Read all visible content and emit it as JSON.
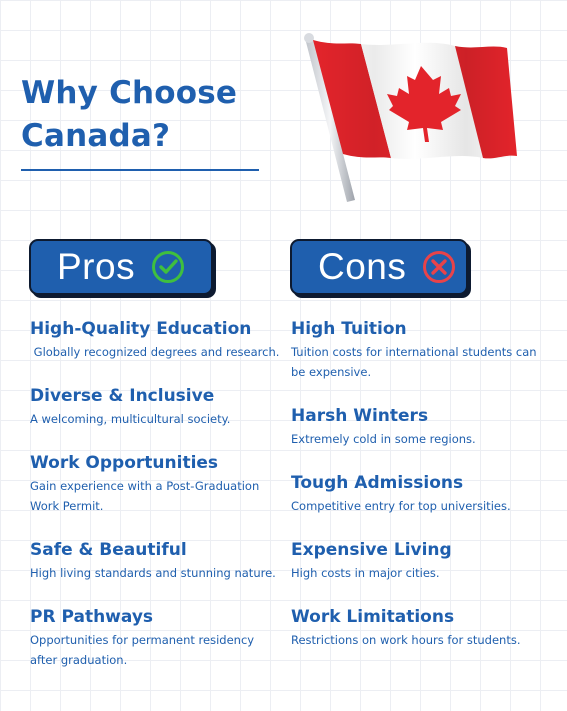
{
  "header": {
    "title_line1": "Why Choose",
    "title_line2": "Canada?"
  },
  "colors": {
    "primary_blue": "#1f5fae",
    "check_green": "#3fbf3f",
    "cross_red": "#e8434a",
    "flag_red": "#e3242b"
  },
  "pros": {
    "label": "Pros",
    "icon": "check-circle-icon",
    "items": [
      {
        "title": "High-Quality Education",
        "desc": " Globally recognized degrees and research."
      },
      {
        "title": "Diverse & Inclusive",
        "desc": "A welcoming, multicultural society."
      },
      {
        "title": "Work Opportunities",
        "desc": "Gain experience with a Post-Graduation Work Permit."
      },
      {
        "title": "Safe & Beautiful",
        "desc": "High living standards and stunning nature."
      },
      {
        "title": "PR Pathways",
        "desc": "Opportunities for permanent residency after graduation."
      }
    ]
  },
  "cons": {
    "label": "Cons",
    "icon": "x-circle-icon",
    "items": [
      {
        "title": "High Tuition",
        "desc": "Tuition costs for international students can be expensive."
      },
      {
        "title": "Harsh Winters",
        "desc": "Extremely cold in some regions."
      },
      {
        "title": "Tough Admissions",
        "desc": "Competitive entry for top universities."
      },
      {
        "title": "Expensive Living",
        "desc": "High costs in major cities."
      },
      {
        "title": "Work Limitations",
        "desc": "Restrictions on work hours for students."
      }
    ]
  }
}
